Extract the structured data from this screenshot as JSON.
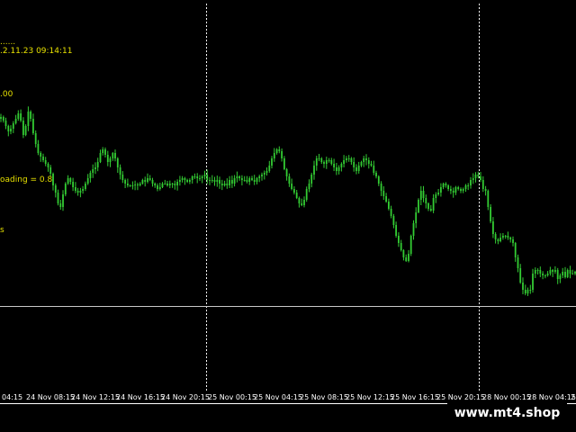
{
  "indicator_text": {
    "line1": "......",
    "line2": ".2.11.23 09:14:11",
    "line3": ".00",
    "line4": "oading = 0.8",
    "line5": "s"
  },
  "time_axis": {
    "labels": [
      "04:15",
      "24 Nov 08:15",
      "24 Nov 12:15",
      "24 Nov 16:15",
      "24 Nov 20:15",
      "25 Nov 00:15",
      "25 Nov 04:15",
      "25 Nov 08:15",
      "25 Nov 12:15",
      "25 Nov 16:15",
      "25 Nov 20:15",
      "28 Nov 00:15",
      "28 Nov 04:15",
      "2"
    ]
  },
  "watermark": "www.mt4.shop",
  "colors": {
    "background": "#000000",
    "candle": "#33cc33",
    "grid": "#ffffff",
    "text": "#e6e000",
    "axis_text": "#ffffff"
  },
  "chart_data": {
    "type": "candlestick",
    "title": "",
    "series_close": [
      130,
      134,
      140,
      146,
      143,
      137,
      132,
      126,
      134,
      150,
      140,
      124,
      132,
      148,
      160,
      170,
      174,
      178,
      182,
      186,
      193,
      206,
      214,
      226,
      230,
      216,
      204,
      198,
      202,
      208,
      212,
      214,
      212,
      210,
      204,
      198,
      192,
      188,
      186,
      180,
      170,
      166,
      172,
      180,
      176,
      170,
      176,
      186,
      194,
      200,
      204,
      206,
      206,
      206,
      205,
      206,
      204,
      200,
      202,
      198,
      200,
      204,
      206,
      210,
      208,
      204,
      204,
      206,
      204,
      204,
      206,
      202,
      200,
      198,
      200,
      202,
      200,
      196,
      196,
      198,
      198,
      196,
      194,
      200,
      200,
      200,
      202,
      200,
      204,
      206,
      204,
      206,
      200,
      204,
      198,
      196,
      198,
      200,
      200,
      202,
      198,
      200,
      202,
      198,
      196,
      194,
      192,
      190,
      184,
      176,
      170,
      166,
      168,
      176,
      188,
      196,
      204,
      210,
      214,
      220,
      226,
      228,
      222,
      210,
      204,
      194,
      184,
      176,
      176,
      180,
      182,
      178,
      178,
      182,
      186,
      190,
      186,
      182,
      178,
      176,
      176,
      180,
      186,
      190,
      184,
      180,
      176,
      178,
      182,
      184,
      192,
      196,
      204,
      212,
      218,
      224,
      232,
      240,
      250,
      262,
      270,
      278,
      286,
      290,
      282,
      262,
      248,
      236,
      222,
      212,
      220,
      226,
      232,
      234,
      220,
      216,
      214,
      208,
      204,
      206,
      210,
      212,
      214,
      208,
      210,
      212,
      210,
      206,
      206,
      200,
      198,
      194,
      196,
      200,
      210,
      212,
      230,
      246,
      260,
      266,
      268,
      264,
      262,
      262,
      264,
      266,
      270,
      286,
      298,
      314,
      322,
      326,
      322,
      322,
      304,
      300,
      300,
      304,
      306,
      306,
      304,
      300,
      302,
      300,
      310,
      306,
      302,
      308,
      300,
      304,
      304,
      302
    ]
  }
}
